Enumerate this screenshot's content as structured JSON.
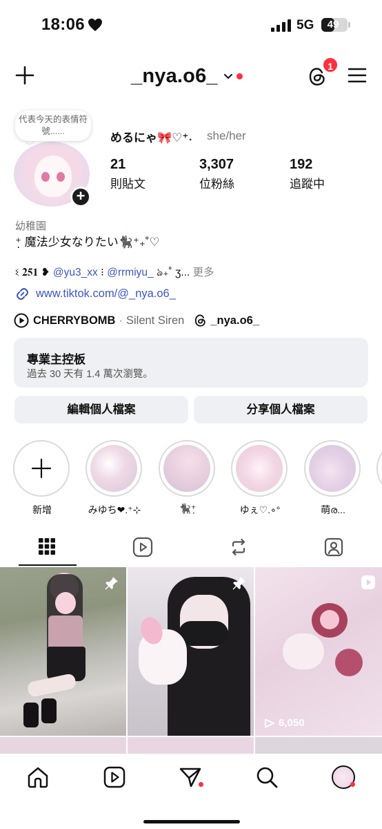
{
  "status_bar": {
    "time": "18:06",
    "network": "5G",
    "battery_level": "49",
    "battery_fraction": 0.49
  },
  "header": {
    "username": "_nya.o6_",
    "notification_count": "1",
    "icons": [
      "plus-icon",
      "chevron-down-icon",
      "threads-icon",
      "menu-icon"
    ]
  },
  "profile": {
    "note": "代表今天的表情符號......",
    "display_name": "めるにゃ🎀♡⁺˖",
    "pronouns": "she/her",
    "stats": [
      {
        "number": "21",
        "label": "則貼文"
      },
      {
        "number": "3,307",
        "label": "位粉絲"
      },
      {
        "number": "192",
        "label": "追蹤中"
      }
    ],
    "category": "幼稚園",
    "bio_line1": "⁺̣ 魔法少女なりたい🐈‍⬛⁺₊˚♡",
    "bio_line2_prefix": "ଽ 𝟐𝟓𝟏 ❥ ",
    "bio_mention1": "@yu3_xx",
    "bio_line2_mid": " ⁝ ",
    "bio_mention2": "@rrmiyu_",
    "bio_line2_suffix": " ঌ₊˚ ʒ...",
    "bio_more": "更多",
    "link": "www.tiktok.com/@_nya.o6_",
    "music_song": "CHERRYBOMB",
    "music_sep": "·",
    "music_artist": "Silent Siren",
    "threads_handle": "_nya.o6_"
  },
  "dashboard": {
    "title": "專業主控板",
    "subtitle": "過去 30 天有 1.4 萬次瀏覽。"
  },
  "actions": {
    "edit_label": "編輯個人檔案",
    "share_label": "分享個人檔案"
  },
  "highlights": [
    {
      "label": "新增"
    },
    {
      "label": "みゆち❤︎.⁺⊹"
    },
    {
      "label": "🐈‍⬛⁺̣"
    },
    {
      "label": "ゆぇ♡.∘°"
    },
    {
      "label": "萌ര..."
    }
  ],
  "tabs": [
    "grid-icon",
    "reels-icon",
    "reposts-icon",
    "tagged-icon"
  ],
  "grid": {
    "post3_views": "6,050"
  },
  "bottom_nav": [
    "home-icon",
    "reels-icon",
    "direct-icon",
    "search-icon",
    "profile-avatar"
  ],
  "colors": {
    "accent_blue": "#3b56c4",
    "badge_red": "#ff3040",
    "button_gray": "#eff0f3"
  }
}
